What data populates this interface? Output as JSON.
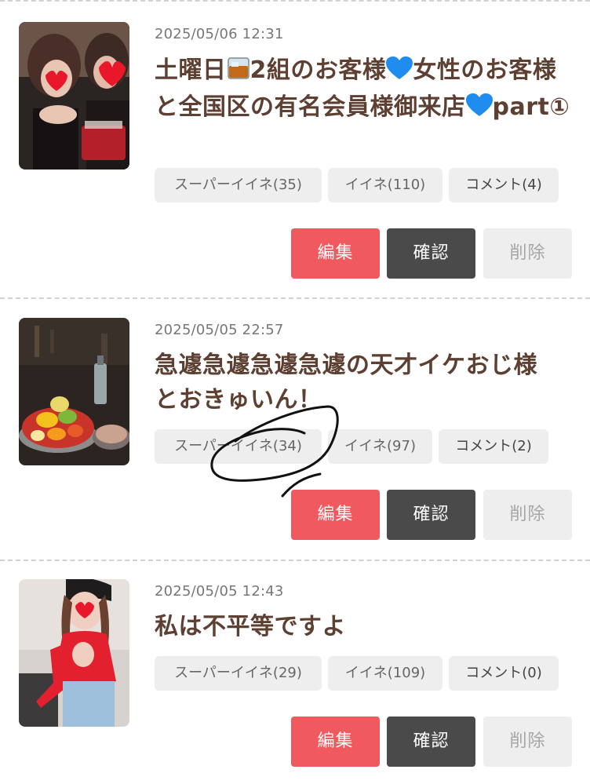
{
  "posts": [
    {
      "date": "2025/05/06 12:31",
      "title_parts": [
        "土曜日",
        "2組のお客様",
        "女性のお客様と全国区の有名会員様御来店",
        "part①"
      ],
      "stats": {
        "super_like": "スーパーイイネ(35)",
        "like": "イイネ(110)",
        "comment": "コメント(4)"
      },
      "buttons": {
        "edit": "編集",
        "confirm": "確認",
        "delete": "削除"
      },
      "icons": [
        "whisky-glass-icon",
        "blue-heart-icon",
        "blue-heart-icon"
      ]
    },
    {
      "date": "2025/05/05 22:57",
      "title_line1": "急遽急遽急遽急遽の天才イケおじ様",
      "title_line2": "とおきゅいん！",
      "stats": {
        "super_like": "スーパーイイネ(34)",
        "like": "イイネ(97)",
        "comment": "コメント(2)"
      },
      "buttons": {
        "edit": "編集",
        "confirm": "確認",
        "delete": "削除"
      }
    },
    {
      "date": "2025/05/05 12:43",
      "title": "私は不平等ですよ",
      "stats": {
        "super_like": "スーパーイイネ(29)",
        "like": "イイネ(109)",
        "comment": "コメント(0)"
      },
      "buttons": {
        "edit": "編集",
        "confirm": "確認",
        "delete": "削除"
      }
    }
  ],
  "colors": {
    "title": "#5e4033",
    "edit_button": "#f0595d",
    "confirm_button": "#4a4a4a",
    "delete_button": "#eeeeee",
    "stat_chip": "#eeeeee"
  }
}
